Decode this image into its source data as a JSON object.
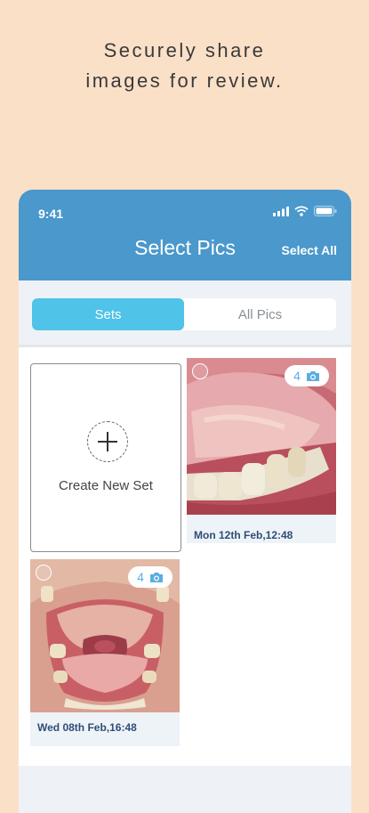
{
  "headline": {
    "line1": "Securely share",
    "line2": "images for review."
  },
  "status_bar": {
    "time": "9:41",
    "icons": [
      "signal-icon",
      "wifi-icon",
      "battery-icon"
    ]
  },
  "appbar": {
    "title": "Select Pics",
    "select_all": "Select All"
  },
  "tabs": [
    {
      "label": "Sets",
      "active": true
    },
    {
      "label": "All Pics",
      "active": false
    }
  ],
  "create_set": {
    "label": "Create New Set",
    "icon": "plus-circle-icon"
  },
  "sets": [
    {
      "count": "4",
      "date": "Mon 12th Feb,12:48",
      "icon": "camera-icon"
    },
    {
      "count": "4",
      "date": "Wed 08th Feb,16:48",
      "icon": "camera-icon"
    }
  ],
  "colors": {
    "accent": "#4a98cc",
    "tab_active": "#4fc3e8",
    "background": "#fbe0c8",
    "date_text": "#2f4d78"
  }
}
